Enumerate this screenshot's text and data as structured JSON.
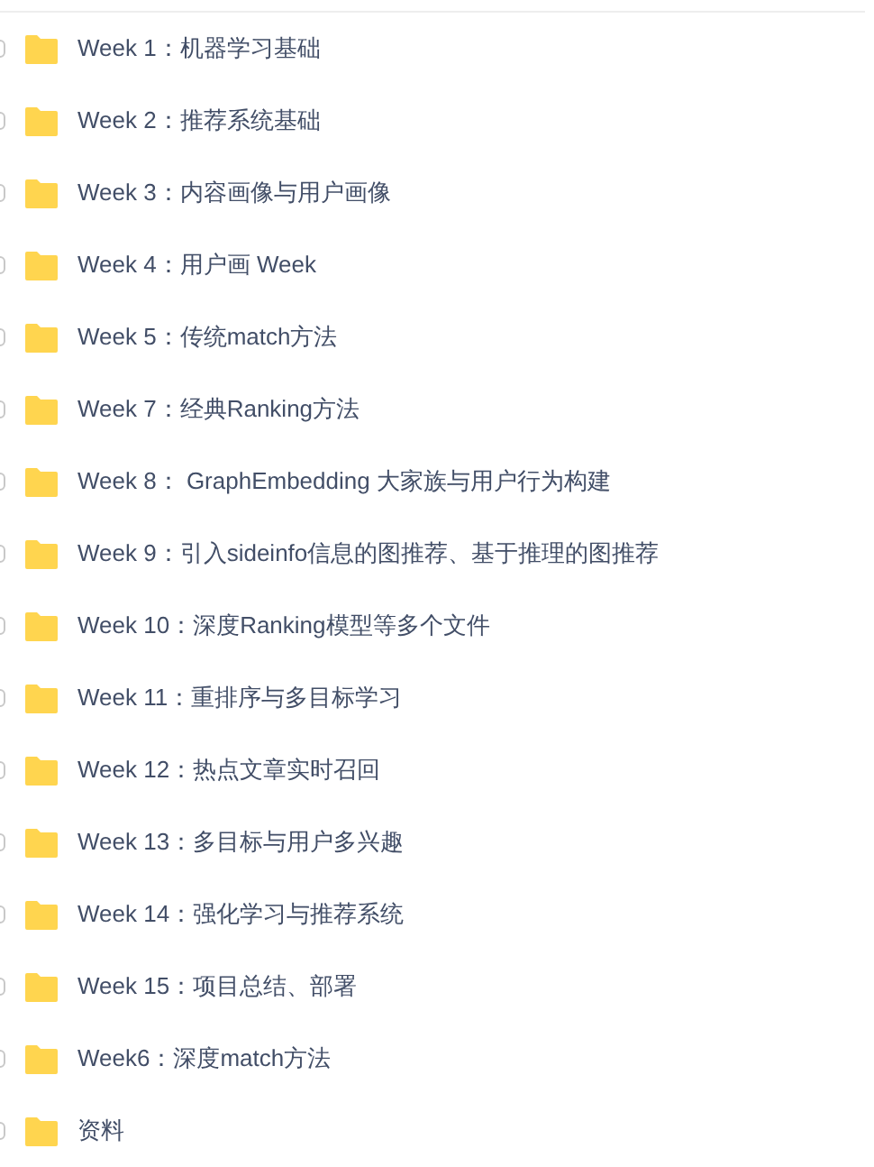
{
  "files": [
    {
      "name": "Week 1：机器学习基础",
      "checked": false
    },
    {
      "name": "Week 2：推荐系统基础",
      "checked": false
    },
    {
      "name": "Week 3：内容画像与用户画像",
      "checked": false
    },
    {
      "name": "Week 4：用户画 Week",
      "checked": false
    },
    {
      "name": "Week 5：传统match方法",
      "checked": false
    },
    {
      "name": "Week 7：经典Ranking方法",
      "checked": false
    },
    {
      "name": "Week 8： GraphEmbedding 大家族与用户行为构建",
      "checked": false
    },
    {
      "name": "Week 9：引入sideinfo信息的图推荐、基于推理的图推荐",
      "checked": false
    },
    {
      "name": "Week 10：深度Ranking模型等多个文件",
      "checked": false
    },
    {
      "name": "Week 11：重排序与多目标学习",
      "checked": false
    },
    {
      "name": "Week 12：热点文章实时召回",
      "checked": false
    },
    {
      "name": "Week 13：多目标与用户多兴趣",
      "checked": false
    },
    {
      "name": "Week 14：强化学习与推荐系统",
      "checked": false
    },
    {
      "name": "Week 15：项目总结、部署",
      "checked": false
    },
    {
      "name": "Week6：深度match方法",
      "checked": false
    },
    {
      "name": "资料",
      "checked": false
    }
  ]
}
